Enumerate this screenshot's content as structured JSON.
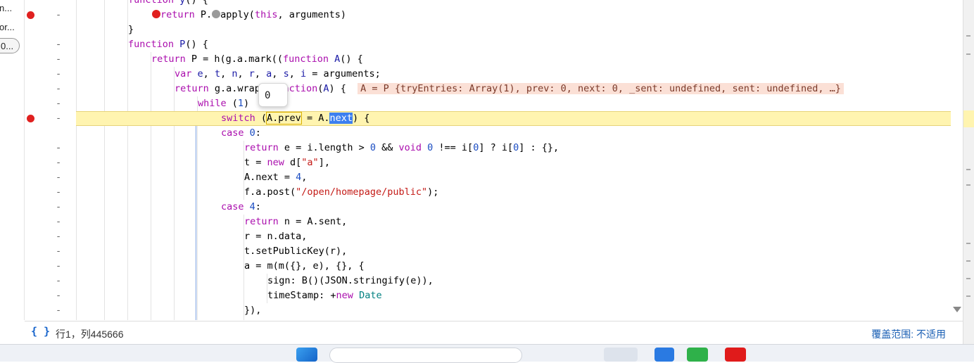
{
  "left_panel": {
    "items": [
      "n...",
      "or..."
    ],
    "pill_label": "0..."
  },
  "editor": {
    "tooltip_value": "0",
    "inline_value": "A = P {tryEntries: Array(1), prev: 0, next: 0, _sent: undefined, sent: undefined, …}",
    "gutter_dash": "-"
  },
  "status_bar": {
    "pretty_print_icon": "{ }",
    "position": "行1，列445666",
    "coverage": "覆盖范围: 不适用"
  },
  "colors": {
    "breakpoint": "#e0201f",
    "active_line": "#fff4b0",
    "selection": "#3c7ff0",
    "inline_value_bg": "#fbe0d6"
  },
  "taskbar": {
    "icons": [
      "windows-start-icon",
      "search-box",
      "app-icon-1",
      "app-icon-2",
      "app-icon-3",
      "app-icon-4"
    ]
  }
}
